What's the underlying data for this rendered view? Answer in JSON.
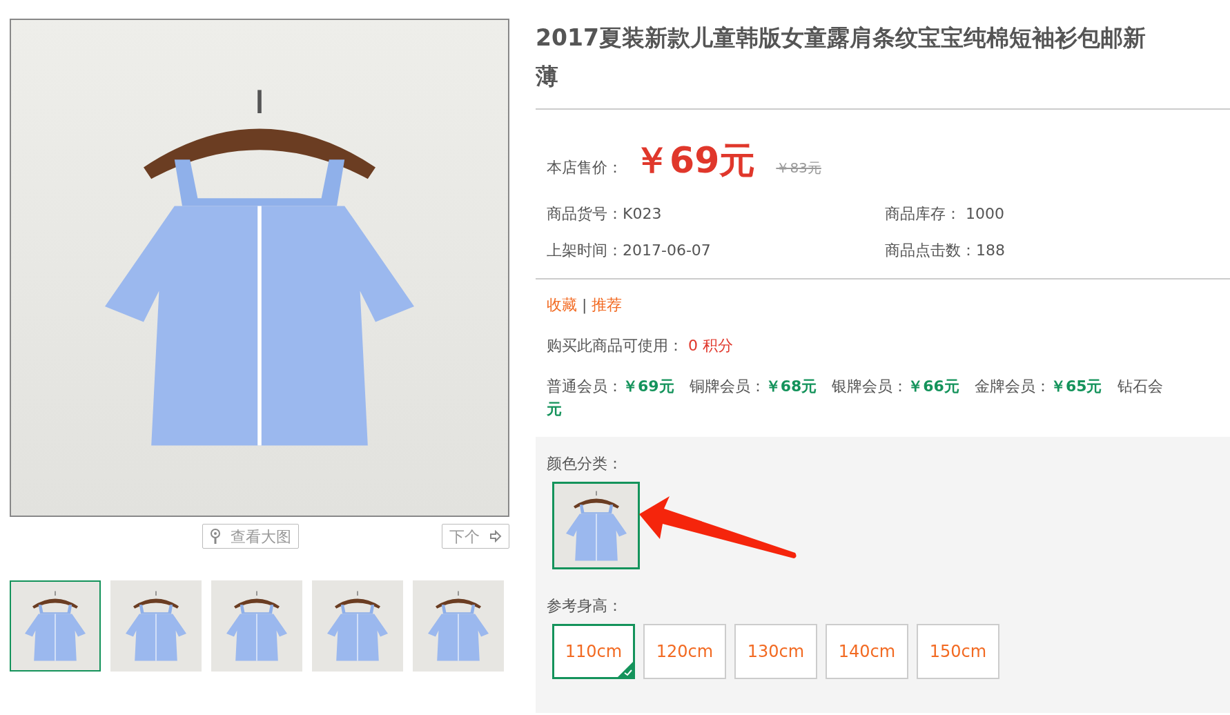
{
  "gallery": {
    "view_large": "查看大图",
    "next": "下个",
    "thumbnails": [
      {
        "selected": true
      },
      {
        "selected": false
      },
      {
        "selected": false
      },
      {
        "selected": false
      },
      {
        "selected": false
      }
    ]
  },
  "product": {
    "title_lines": [
      "2017夏装新款儿童韩版女童露肩条纹宝宝纯棉短袖衫包邮新",
      "薄"
    ],
    "price_label": "本店售价：",
    "price": "￥69元",
    "original_price": "￥83元",
    "info": [
      {
        "label": "商品货号：",
        "value": "K023"
      },
      {
        "label": "商品库存：",
        "value": " 1000"
      },
      {
        "label": "上架时间：",
        "value": "2017-06-07"
      },
      {
        "label": "商品点击数：",
        "value": "188"
      }
    ],
    "favorite": "收藏",
    "separator": "|",
    "recommend": "推荐",
    "points_label": "购买此商品可使用：",
    "points": "0 积分",
    "member_prices": [
      {
        "label": "普通会员：",
        "price": "￥69元"
      },
      {
        "label": "铜牌会员：",
        "price": "￥68元"
      },
      {
        "label": "银牌会员：",
        "price": "￥66元"
      },
      {
        "label": "金牌会员：",
        "price": "￥65元"
      }
    ],
    "member_cut_label": "钻石会",
    "member_tail": "元"
  },
  "options": {
    "color_label": "颜色分类：",
    "colors": [
      {
        "selected": true
      }
    ],
    "size_label": "参考身高：",
    "sizes": [
      {
        "label": "110cm",
        "selected": true
      },
      {
        "label": "120cm",
        "selected": false
      },
      {
        "label": "130cm",
        "selected": false
      },
      {
        "label": "140cm",
        "selected": false
      },
      {
        "label": "150cm",
        "selected": false
      }
    ]
  }
}
